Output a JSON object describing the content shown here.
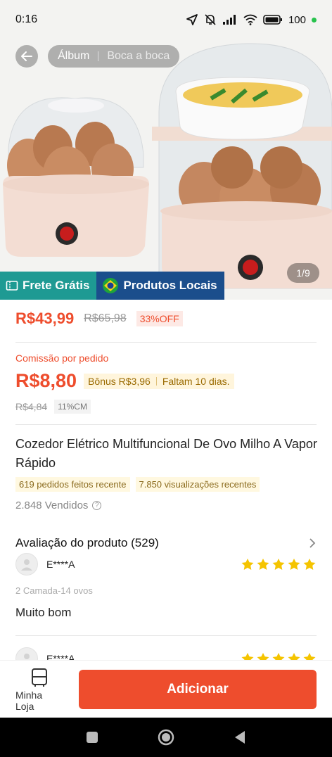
{
  "status_bar": {
    "time": "0:16",
    "battery": "100"
  },
  "hero": {
    "tab_album": "Álbum",
    "tab_reviews": "Boca a boca",
    "image_counter": "1/9",
    "badge_free_shipping": "Frete Grátis",
    "badge_local": "Produtos Locais"
  },
  "price": {
    "current": "R$43,99",
    "original": "R$65,98",
    "discount": "33%OFF"
  },
  "commission": {
    "label": "Comissão por pedido",
    "value": "R$8,80",
    "bonus": "Bônus R$3,96",
    "remaining": "Faltam 10 dias.",
    "old_value": "R$4,84",
    "rate": "11%CM"
  },
  "product": {
    "title": "Cozedor Elétrico Multifuncional De Ovo Milho A Vapor Rápido",
    "recent_orders": "619 pedidos feitos recente",
    "recent_views": "7.850 visualizações recentes",
    "sold": "2.848 Vendidos"
  },
  "reviews": {
    "title": "Avaliação do produto (529)",
    "items": [
      {
        "user": "E****A",
        "rating": 5,
        "variant": "2 Camada-14 ovos",
        "text": "Muito bom"
      },
      {
        "user": "E****A",
        "rating": 5
      }
    ]
  },
  "bottom_bar": {
    "store_label": "Minha Loja",
    "add_label": "Adicionar"
  },
  "colors": {
    "accent": "#ee4d2d",
    "star": "#f5c400",
    "teal": "#1e9a93",
    "navy": "#1b4e8c"
  }
}
